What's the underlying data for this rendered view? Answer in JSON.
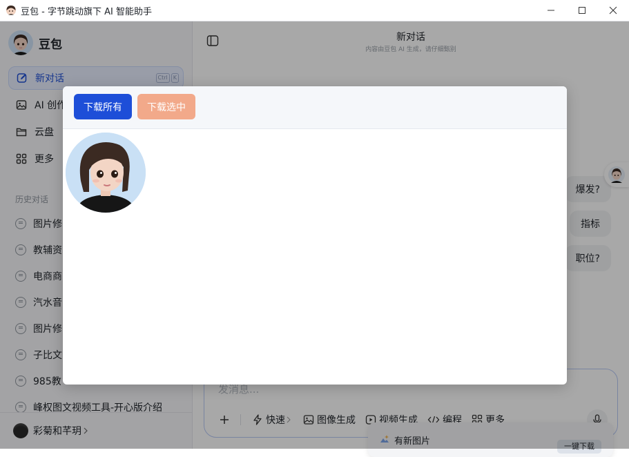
{
  "window": {
    "title": "豆包 - 字节跳动旗下 AI 智能助手",
    "controls": [
      "minimize-icon",
      "maximize-icon",
      "close-icon"
    ]
  },
  "sidebar": {
    "brand": "豆包",
    "nav": [
      {
        "label": "新对话",
        "icon": "edit-icon",
        "shortcut": [
          "Ctrl",
          "K"
        ]
      },
      {
        "label": "AI 创作",
        "icon": "image-icon"
      },
      {
        "label": "云盘",
        "icon": "folder-icon"
      },
      {
        "label": "更多",
        "icon": "grid-icon"
      }
    ],
    "history_label": "历史对话",
    "history": [
      "图片修",
      "教辅资",
      "电商商",
      "汽水音",
      "图片修",
      "子比文",
      "985教",
      "峰权图文视频工具-开心版介绍"
    ],
    "user": "彩菊和芊玥"
  },
  "main": {
    "title": "新对话",
    "subtitle": "内容由豆包 AI 生成，请仔细甄别",
    "suggestions": [
      "爆发?",
      "指标",
      "职位?"
    ],
    "composer_placeholder": "发消息...",
    "tools": [
      {
        "label": "快速",
        "icon": "bolt-icon"
      },
      {
        "label": "图像生成",
        "icon": "image-icon"
      },
      {
        "label": "视频生成",
        "icon": "play-icon"
      },
      {
        "label": "编程",
        "icon": "code-icon"
      },
      {
        "label": "更多",
        "icon": "grid-icon"
      }
    ],
    "toast": {
      "text": "有新图片",
      "button": "一键下载"
    }
  },
  "modal": {
    "download_all": "下载所有",
    "download_selected": "下载选中"
  },
  "colors": {
    "primary": "#1d4ed8",
    "secondary": "#f2a98a"
  }
}
